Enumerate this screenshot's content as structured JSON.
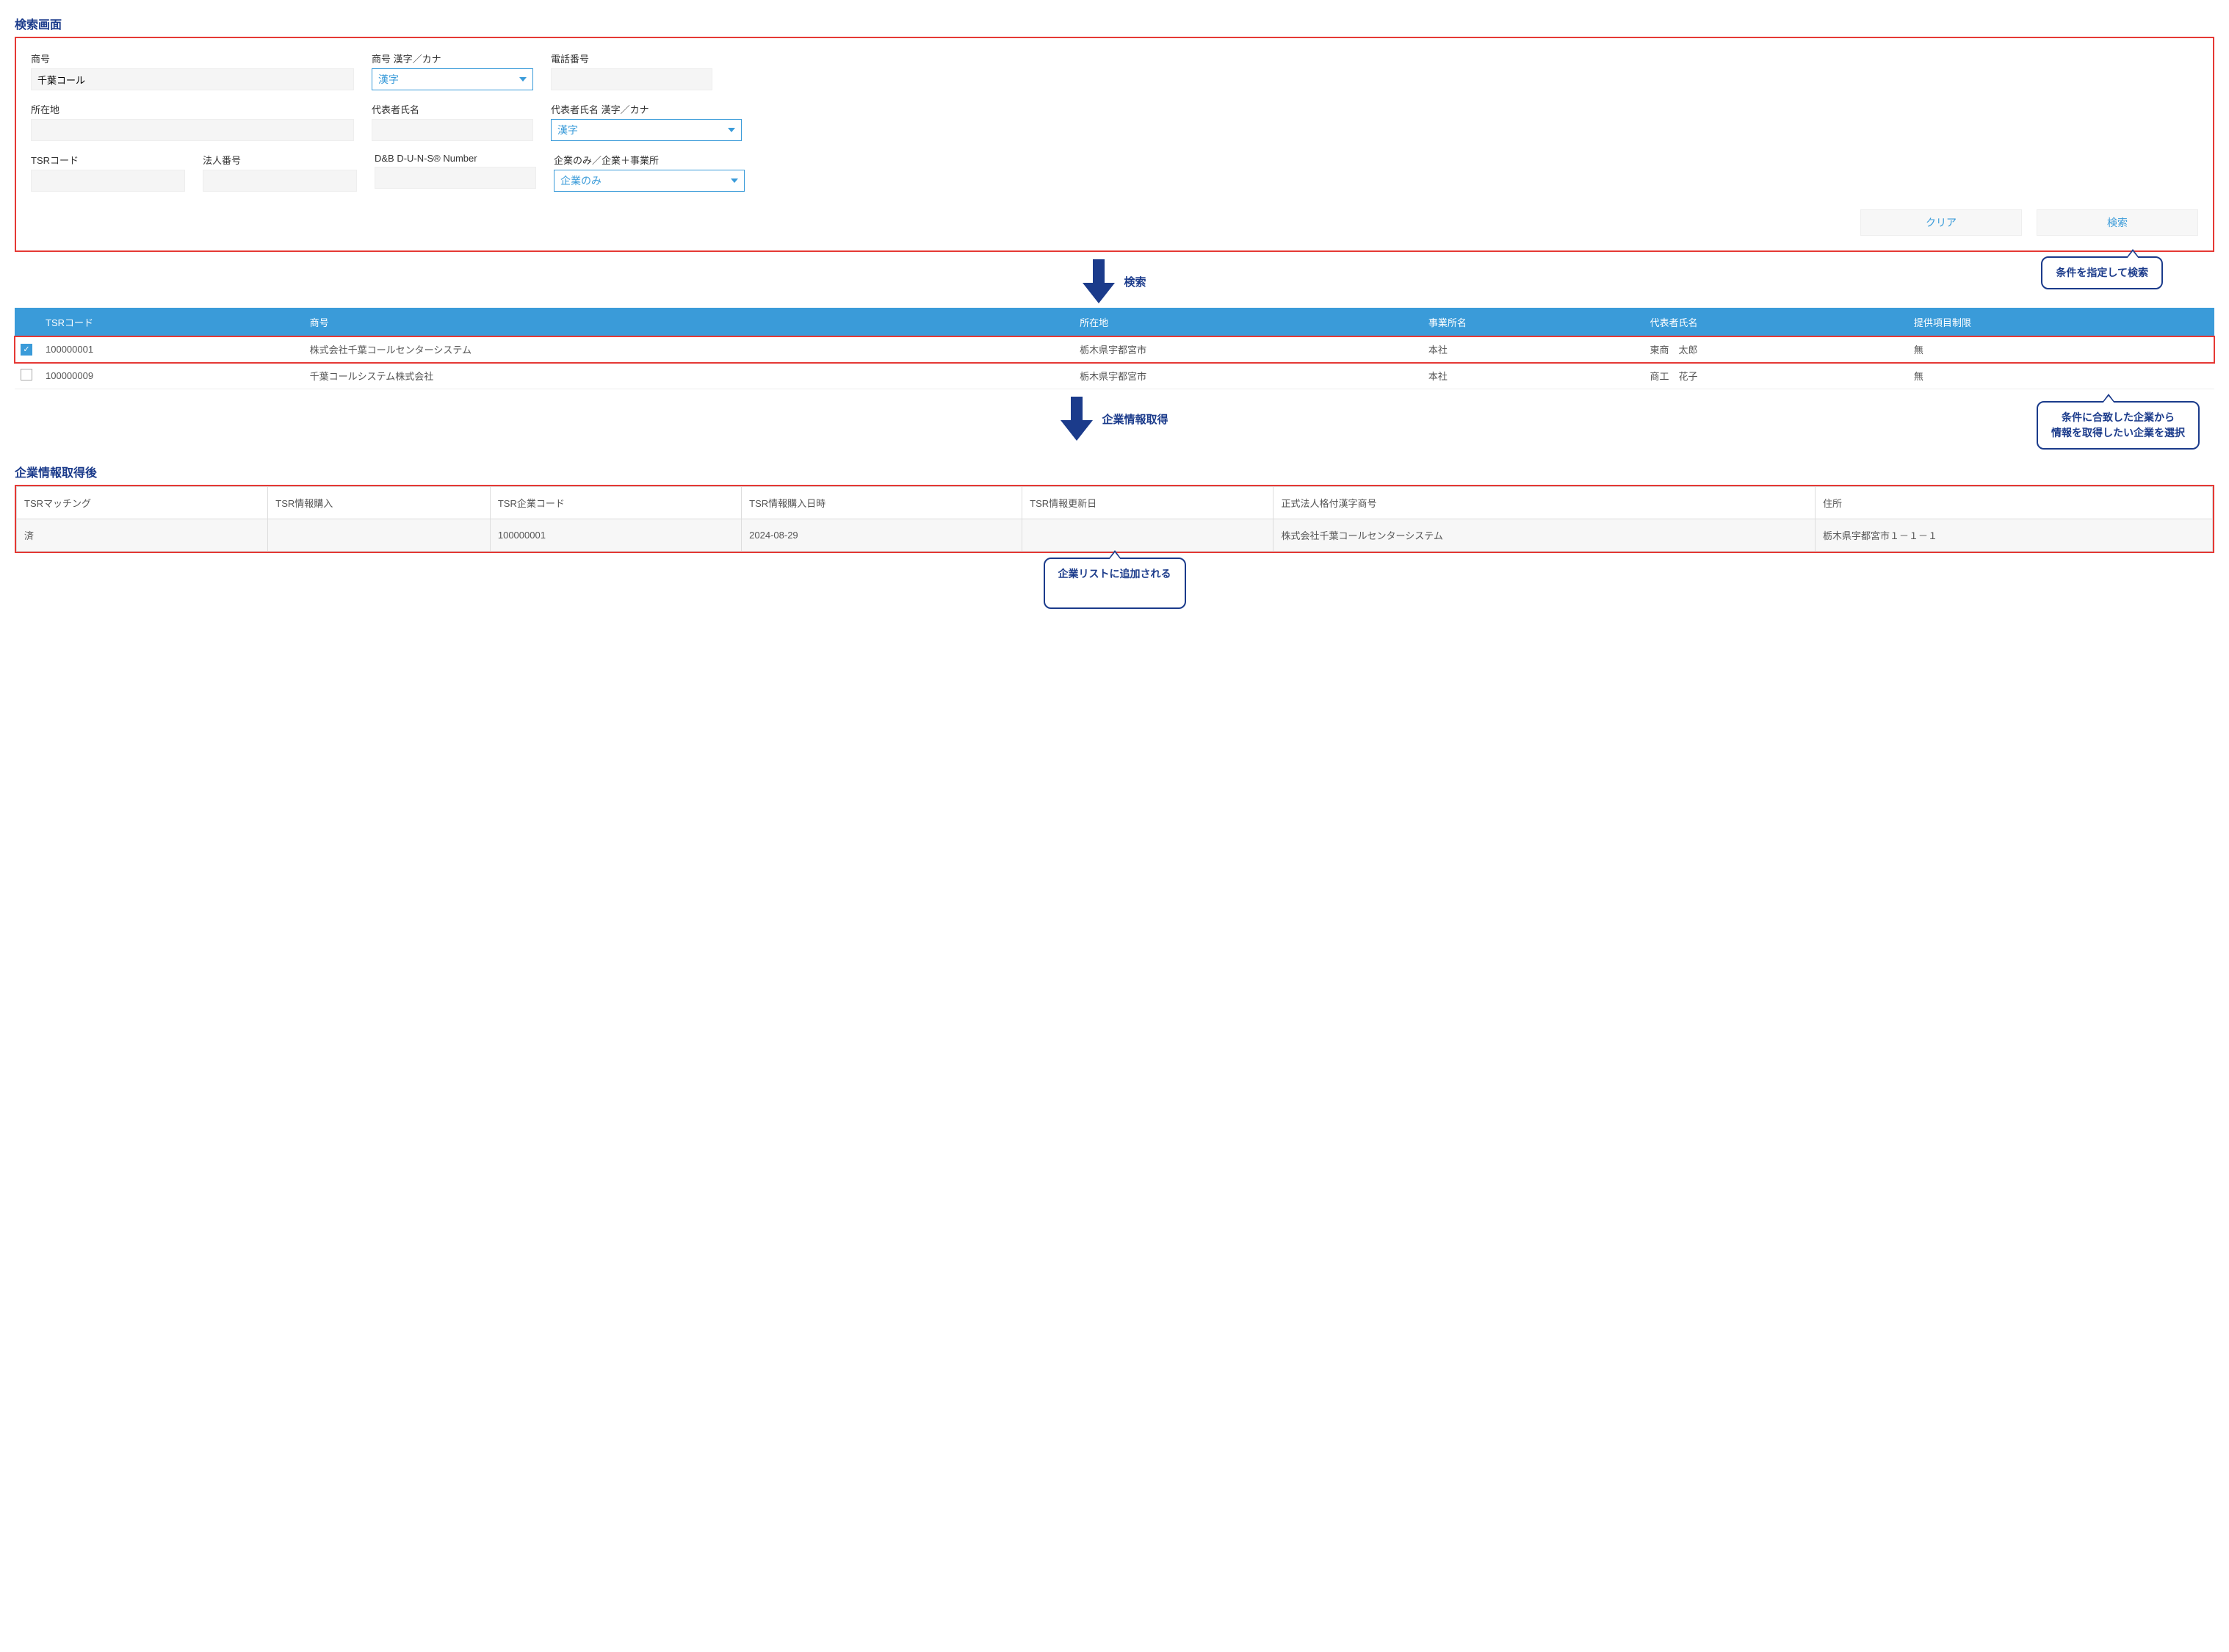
{
  "sections": {
    "search_title": "検索画面",
    "result_title": "企業情報取得後"
  },
  "form": {
    "company_name": {
      "label": "商号",
      "value": "千葉コール"
    },
    "company_name_type": {
      "label": "商号 漢字／カナ",
      "value": "漢字"
    },
    "phone": {
      "label": "電話番号",
      "value": ""
    },
    "address": {
      "label": "所在地",
      "value": ""
    },
    "rep_name": {
      "label": "代表者氏名",
      "value": ""
    },
    "rep_name_type": {
      "label": "代表者氏名 漢字／カナ",
      "value": "漢字"
    },
    "tsr_code": {
      "label": "TSRコード",
      "value": ""
    },
    "corp_number": {
      "label": "法人番号",
      "value": ""
    },
    "duns": {
      "label": "D&B D-U-N-S® Number",
      "value": ""
    },
    "scope": {
      "label": "企業のみ／企業＋事業所",
      "value": "企業のみ"
    }
  },
  "buttons": {
    "clear": "クリア",
    "search": "検索"
  },
  "arrows": {
    "search": "検索",
    "fetch": "企業情報取得"
  },
  "callouts": {
    "c1": "条件を指定して検索",
    "c2_l1": "条件に合致した企業から",
    "c2_l2": "情報を取得したい企業を選択",
    "c3": "企業リストに追加される"
  },
  "results": {
    "headers": {
      "tsr": "TSRコード",
      "name": "商号",
      "addr": "所在地",
      "office": "事業所名",
      "rep": "代表者氏名",
      "limit": "提供項目制限"
    },
    "rows": [
      {
        "checked": true,
        "tsr": "100000001",
        "name": "株式会社千葉コールセンターシステム",
        "addr": "栃木県宇都宮市",
        "office": "本社",
        "rep": "東商　太郎",
        "limit": "無"
      },
      {
        "checked": false,
        "tsr": "100000009",
        "name": "千葉コールシステム株式会社",
        "addr": "栃木県宇都宮市",
        "office": "本社",
        "rep": "商工　花子",
        "limit": "無"
      }
    ]
  },
  "detail": {
    "headers": {
      "match": "TSRマッチング",
      "purchase": "TSR情報購入",
      "code": "TSR企業コード",
      "purchase_date": "TSR情報購入日時",
      "update_date": "TSR情報更新日",
      "formal_name": "正式法人格付漢字商号",
      "addr": "住所"
    },
    "row": {
      "match": "済",
      "purchase": "",
      "code": "100000001",
      "purchase_date": "2024-08-29",
      "update_date": "",
      "formal_name": "株式会社千葉コールセンターシステム",
      "addr": "栃木県宇都宮市１－１－１"
    }
  }
}
